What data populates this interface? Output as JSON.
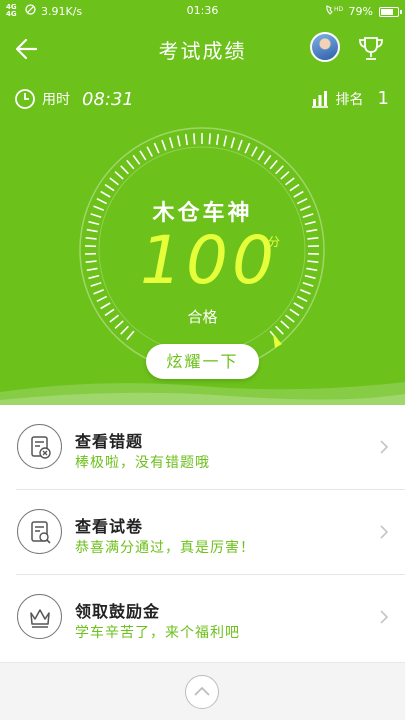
{
  "status_bar": {
    "network": "4G 4G",
    "speed": "3.91K/s",
    "time": "01:36",
    "signal": "HD",
    "battery": "79%",
    "battery_level": 0.79
  },
  "header": {
    "title": "考试成绩"
  },
  "info": {
    "time_label": "用时",
    "time_value": "08:31",
    "rank_label": "排名",
    "rank_value": "1"
  },
  "score": {
    "title": "木仓车神",
    "value": "100",
    "unit": "分",
    "status": "合格",
    "button_label": "炫耀一下"
  },
  "menu": [
    {
      "title": "查看错题",
      "subtitle": "棒极啦，没有错题哦",
      "icon": "wrong-questions-icon"
    },
    {
      "title": "查看试卷",
      "subtitle": "恭喜满分通过，真是厉害！",
      "icon": "exam-paper-icon"
    },
    {
      "title": "领取鼓励金",
      "subtitle": "学车辛苦了，来个福利吧",
      "icon": "crown-icon"
    }
  ],
  "colors": {
    "primary_green": "#6cc11b",
    "score_yellow": "#e5ff3a",
    "subtitle_green": "#6cc11b"
  }
}
